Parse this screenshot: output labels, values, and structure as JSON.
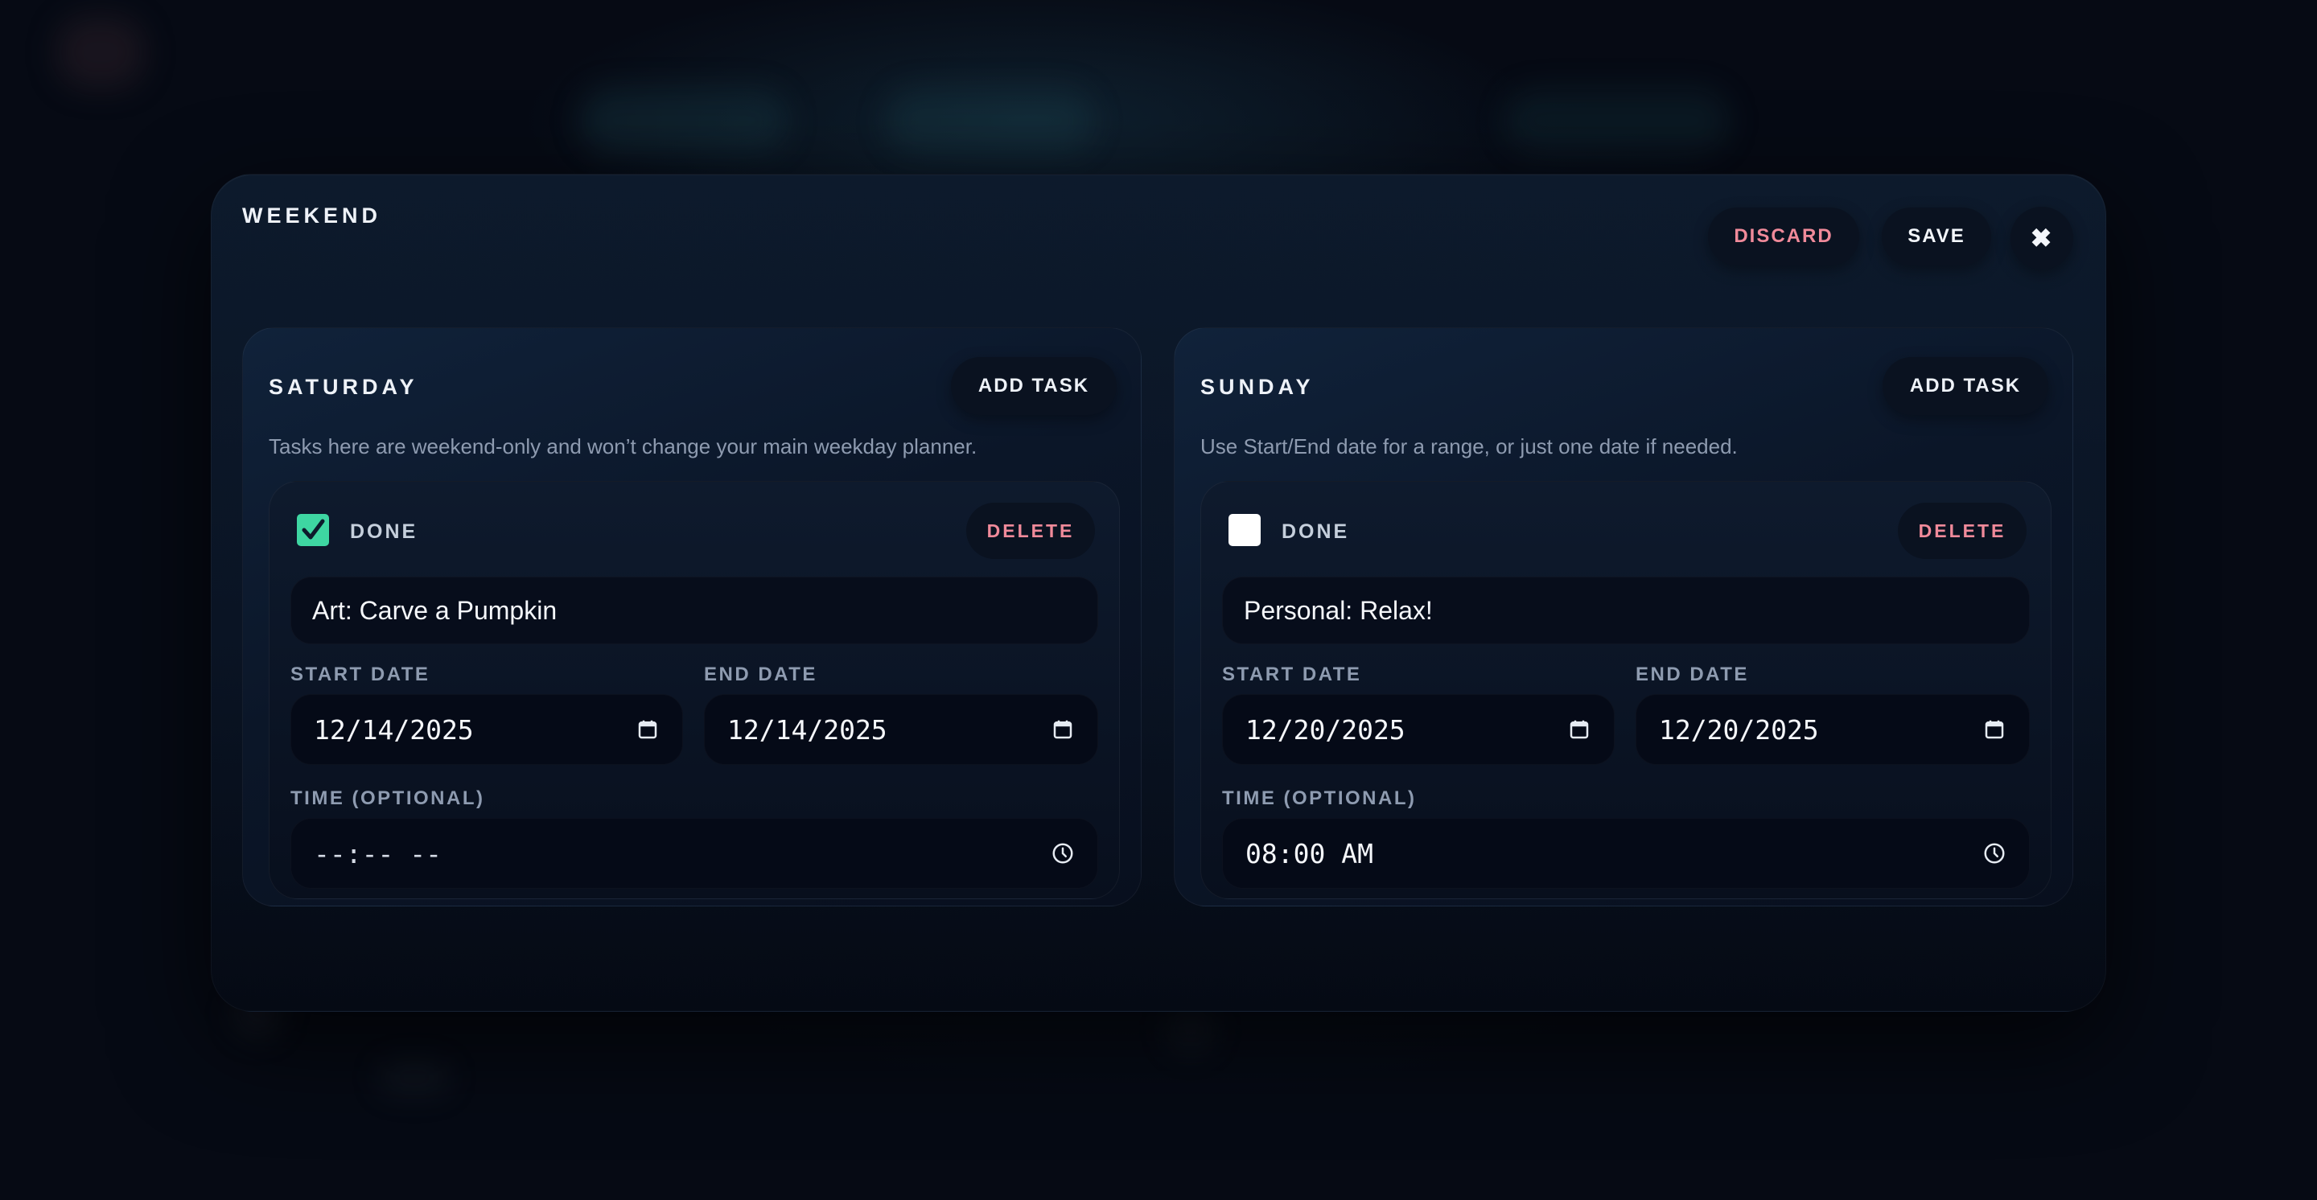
{
  "modal": {
    "title": "WEEKEND",
    "discard_label": "DISCARD",
    "save_label": "SAVE",
    "close_glyph": "✖"
  },
  "days": [
    {
      "title": "SATURDAY",
      "add_task_label": "ADD TASK",
      "description": "Tasks here are weekend-only and won’t change your main weekday planner.",
      "task": {
        "done": true,
        "done_label": "DONE",
        "delete_label": "DELETE",
        "title": "Art: Carve a Pumpkin",
        "start_date_label": "START DATE",
        "start_date": "12/14/2025",
        "end_date_label": "END DATE",
        "end_date": "12/14/2025",
        "time_label": "TIME (OPTIONAL)",
        "time": "--:-- --"
      }
    },
    {
      "title": "SUNDAY",
      "add_task_label": "ADD TASK",
      "description": "Use Start/End date for a range, or just one date if needed.",
      "task": {
        "done": false,
        "done_label": "DONE",
        "delete_label": "DELETE",
        "title": "Personal: Relax!",
        "start_date_label": "START DATE",
        "start_date": "12/20/2025",
        "end_date_label": "END DATE",
        "end_date": "12/20/2025",
        "time_label": "TIME (OPTIONAL)",
        "time": "08:00 AM"
      }
    }
  ],
  "icons": {
    "calendar": "calendar-icon",
    "clock": "clock-icon",
    "check": "checkmark-icon"
  },
  "colors": {
    "accent_green": "#3ed6a2",
    "danger_pink": "#f08a9a",
    "panel_bg": "#0b1628"
  }
}
